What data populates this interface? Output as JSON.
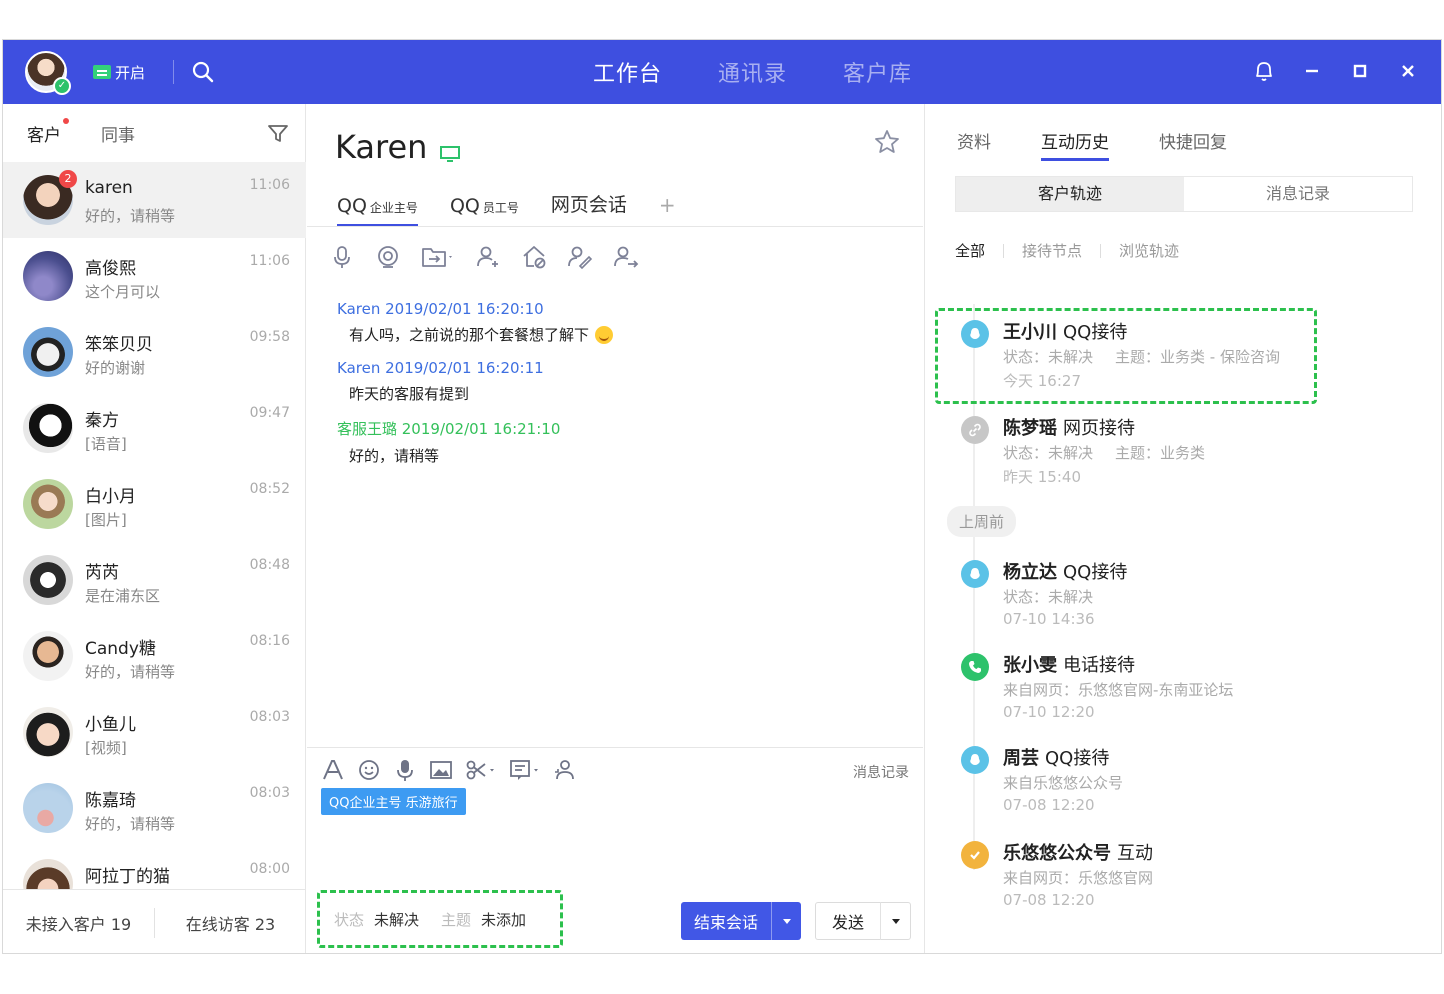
{
  "topbar": {
    "status_label": "开启",
    "nav": [
      "工作台",
      "通讯录",
      "客户库"
    ],
    "nav_active": 0,
    "accent_color": "#3e4fe0"
  },
  "left": {
    "tabs": [
      "客户",
      "同事"
    ],
    "conversations": [
      {
        "name": "karen",
        "message": "好的，请稍等",
        "time": "11:06",
        "badge": "2"
      },
      {
        "name": "高俊熙",
        "message": "这个月可以",
        "time": "11:06"
      },
      {
        "name": "笨笨贝贝",
        "message": "好的谢谢",
        "time": "09:58"
      },
      {
        "name": "秦方",
        "message": "[语音]",
        "time": "09:47"
      },
      {
        "name": "白小月",
        "message": "[图片]",
        "time": "08:52"
      },
      {
        "name": "芮芮",
        "message": "是在浦东区",
        "time": "08:48"
      },
      {
        "name": "Candy糖",
        "message": "好的，请稍等",
        "time": "08:16"
      },
      {
        "name": "小鱼儿",
        "message": "[视频]",
        "time": "08:03"
      },
      {
        "name": "陈嘉琦",
        "message": "好的，请稍等",
        "time": "08:03"
      },
      {
        "name": "阿拉丁的猫",
        "message": "",
        "time": "08:00"
      }
    ],
    "footer": {
      "pending": "未接入客户 19",
      "online": "在线访客 23"
    }
  },
  "chat": {
    "name": "Karen",
    "channel_tabs": [
      {
        "main": "QQ",
        "sub": "企业主号"
      },
      {
        "main": "QQ",
        "sub": "员工号"
      },
      {
        "main": "网页会话",
        "sub": ""
      }
    ],
    "plus": "+",
    "messages": [
      {
        "head": "Karen 2019/02/01 16:20:10",
        "body": "有人吗，之前说的那个套餐想了解下",
        "staff": false,
        "emoji": true
      },
      {
        "head": "Karen 2019/02/01 16:20:11",
        "body": "昨天的客服有提到",
        "staff": false,
        "emoji": false
      },
      {
        "head": "客服王璐 2019/02/01 16:21:10",
        "body": "好的，请稍等",
        "staff": true,
        "emoji": false
      }
    ],
    "history_link": "消息记录",
    "tag": "QQ企业主号 乐游旅行",
    "status_label": "状态",
    "status_value": "未解决",
    "topic_label": "主题",
    "topic_value": "未添加",
    "end_button": "结束会话",
    "send_button": "发送"
  },
  "right": {
    "tabs": [
      "资料",
      "互动历史",
      "快捷回复"
    ],
    "segments": [
      "客户轨迹",
      "消息记录"
    ],
    "filters": [
      "全部",
      "接待节点",
      "浏览轨迹"
    ],
    "week_label": "上周前",
    "timeline": [
      {
        "name": "王小川",
        "type": "QQ接待",
        "sub1": "状态：未解决",
        "sub2": "主题：业务类 - 保险咨询",
        "time": "今天  16:27",
        "icon": "qq-icon",
        "color": "#5bc2e7"
      },
      {
        "name": "陈梦瑶",
        "type": "网页接待",
        "sub1": "状态：未解决",
        "sub2": "主题：业务类",
        "time": "昨天  15:40",
        "icon": "link-icon",
        "color": "#c7c7c7"
      },
      {
        "name": "杨立达",
        "type": "QQ接待",
        "sub1": "状态：未解决",
        "sub2": "",
        "time": "07-10 14:36",
        "icon": "qq-icon",
        "color": "#5bc2e7"
      },
      {
        "name": "张小雯",
        "type": "电话接待",
        "sub1": "来自网页：乐悠悠官网-东南亚论坛",
        "sub2": "",
        "time": "07-10 12:20",
        "icon": "phone-icon",
        "color": "#2dc26b"
      },
      {
        "name": "周芸",
        "type": "QQ接待",
        "sub1": "来自乐悠悠公众号",
        "sub2": "",
        "time": "07-08  12:20",
        "icon": "qq-icon",
        "color": "#5bc2e7"
      },
      {
        "name": "乐悠悠公众号",
        "type": "互动",
        "sub1": "来自网页：乐悠悠官网",
        "sub2": "",
        "time": "07-08  12:20",
        "icon": "check-icon",
        "color": "#f2b33d"
      }
    ]
  }
}
